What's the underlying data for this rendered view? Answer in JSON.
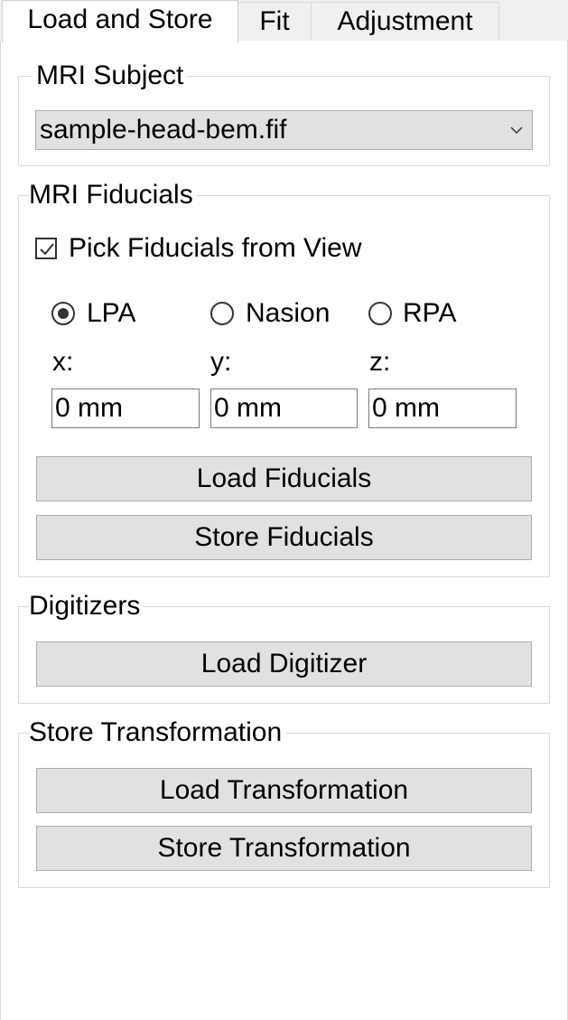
{
  "tabs": [
    {
      "label": "Load and Store",
      "active": true
    },
    {
      "label": "Fit",
      "active": false
    },
    {
      "label": "Adjustment",
      "active": false
    }
  ],
  "mri_subject": {
    "legend": "MRI Subject",
    "selected": "sample-head-bem.fif"
  },
  "mri_fiducials": {
    "legend": "MRI Fiducials",
    "pick_label": "Pick Fiducials from View",
    "pick_checked": true,
    "radios": [
      {
        "label": "LPA",
        "selected": true
      },
      {
        "label": "Nasion",
        "selected": false
      },
      {
        "label": "RPA",
        "selected": false
      }
    ],
    "coords": [
      {
        "label": "x:",
        "value": "0 mm"
      },
      {
        "label": "y:",
        "value": "0 mm"
      },
      {
        "label": "z:",
        "value": "0 mm"
      }
    ],
    "load_label": "Load Fiducials",
    "store_label": "Store Fiducials"
  },
  "digitizers": {
    "legend": "Digitizers",
    "load_label": "Load Digitizer"
  },
  "store_transformation": {
    "legend": "Store Transformation",
    "load_label": "Load Transformation",
    "store_label": "Store Transformation"
  }
}
